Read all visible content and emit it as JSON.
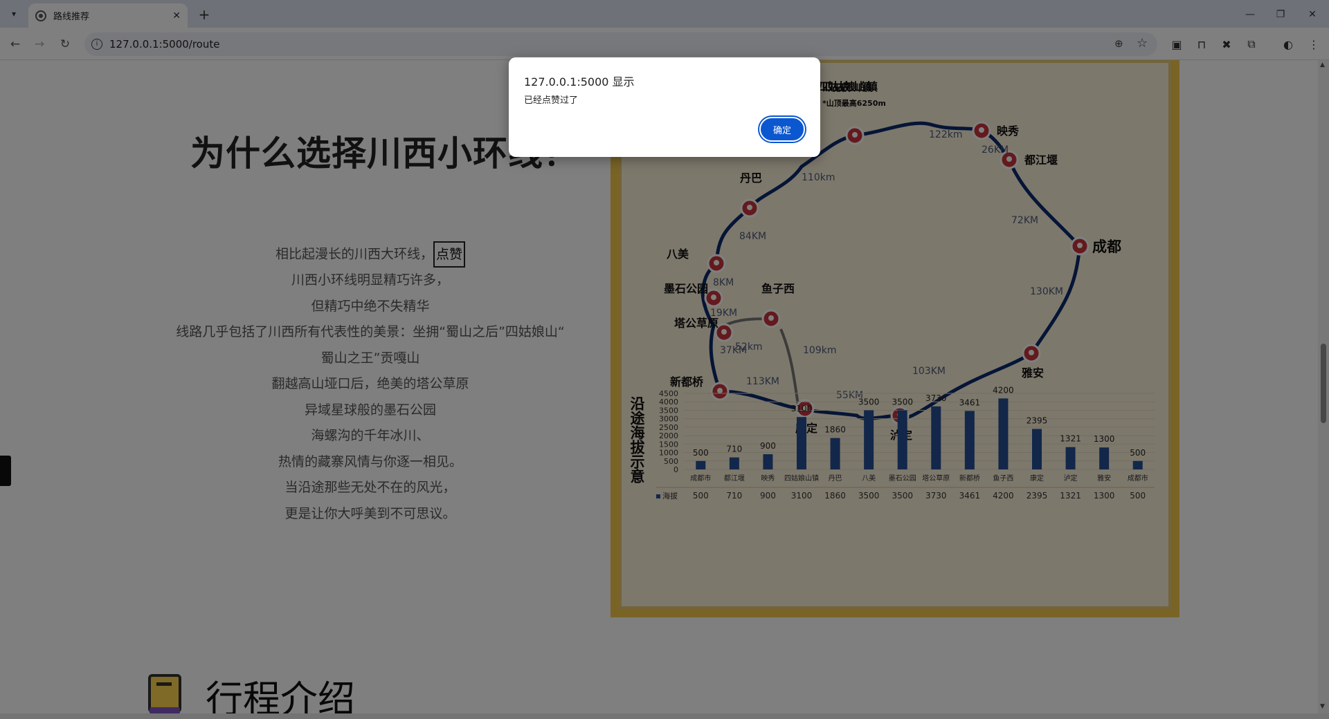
{
  "browser": {
    "tab_title": "路线推荐",
    "url": "127.0.0.1:5000/route"
  },
  "page": {
    "heading": "为什么选择川西小环线？",
    "paragraph_lines": [
      "相比起漫长的川西大环线，",
      "川西小环线明显精巧许多，",
      "但精巧中绝不失精华",
      "线路几乎包括了川西所有代表性的美景：坐拥“蜀山之后”四姑娘山“",
      "蜀山之王”贡嘎山",
      "翻越高山垭口后，绝美的塔公草原",
      "异域星球般的墨石公园",
      "海螺沟的千年冰川、",
      "热情的藏寨风情与你逐一相见。",
      "当沿途那些无处不在的风光，",
      "更是让你大呼美到不可思议。"
    ],
    "like_button": "点赞",
    "section2_title": "行程介绍"
  },
  "map": {
    "title": "四姑娘山镇",
    "subtitle": "*山顶最高6250m",
    "stops": [
      {
        "name": "四姑娘山镇"
      },
      {
        "name": "映秀"
      },
      {
        "name": "都江堰"
      },
      {
        "name": "成都"
      },
      {
        "name": "雅安"
      },
      {
        "name": "泸定"
      },
      {
        "name": "康定"
      },
      {
        "name": "新都桥"
      },
      {
        "name": "塔公草原"
      },
      {
        "name": "墨石公园"
      },
      {
        "name": "八美"
      },
      {
        "name": "丹巴"
      },
      {
        "name": "鱼子西"
      }
    ],
    "distances": [
      "122km",
      "26KM",
      "72KM",
      "130KM",
      "103KM",
      "55KM",
      "113KM",
      "37KM",
      "19KM",
      "8KM",
      "84KM",
      "110km",
      "52km",
      "109km"
    ]
  },
  "chart_data": {
    "type": "bar",
    "title": "沿途海拔示意",
    "categories": [
      "成都市",
      "都江堰",
      "映秀",
      "四姑娘山镇",
      "丹巴",
      "八美",
      "墨石公园",
      "塔公草原",
      "新都桥",
      "鱼子西",
      "康定",
      "泸定",
      "雅安",
      "成都市"
    ],
    "category_labels": [
      "成都市",
      "都江堰",
      "映秀",
      "四姑娘山镇",
      "丹巴",
      "八美",
      "墨石公园",
      "塔公草原",
      "新都桥",
      "鱼子西",
      "康定",
      "泸定",
      "雅安",
      "成都市"
    ],
    "series": [
      {
        "name": "海拔",
        "values": [
          500,
          710,
          900,
          3100,
          1860,
          3500,
          3500,
          3730,
          3461,
          4200,
          2395,
          1321,
          1300,
          500
        ]
      }
    ],
    "yticks": [
      0,
      500,
      1000,
      1500,
      2000,
      2500,
      3000,
      3500,
      4000,
      4500
    ],
    "ylim": [
      0,
      4500
    ]
  },
  "dialog": {
    "title": "127.0.0.1:5000 显示",
    "message": "已经点赞过了",
    "ok_label": "确定"
  },
  "colors": {
    "route_line": "#0a2b6e",
    "marker": "#c8343a",
    "bar": "#244f94",
    "dialog_button": "#0b57d0"
  }
}
